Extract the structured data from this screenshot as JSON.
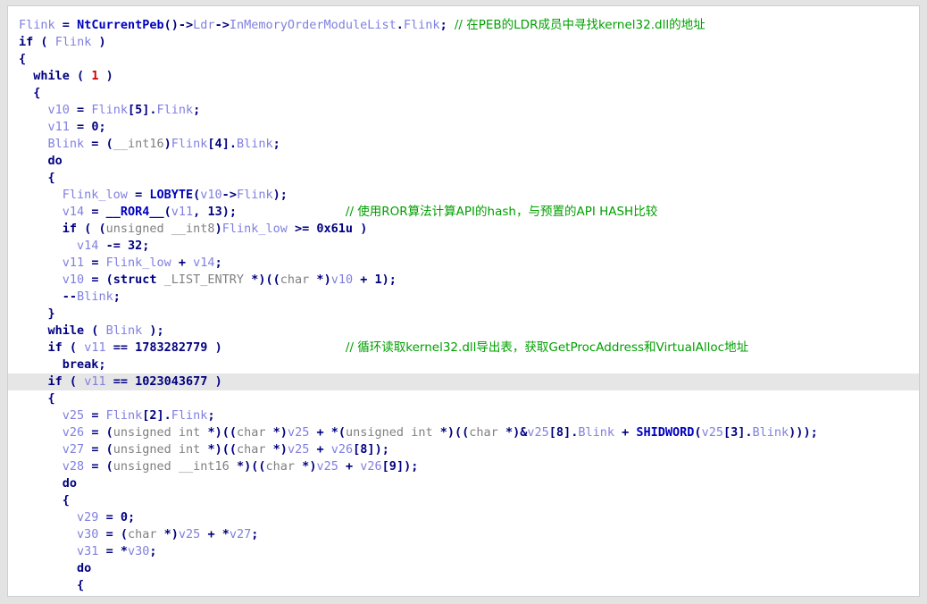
{
  "window": {
    "kind": "decompiler-pseudocode-view",
    "background_color": "#e3e3e3",
    "panel_color": "#ffffff",
    "border_color": "#cfcfcf",
    "highlight_color": "#e6e6e6"
  },
  "colors": {
    "keyword": "#000080",
    "variable": "#8080e0",
    "function": "#0000c0",
    "number": "#000080",
    "number_red": "#d00000",
    "type": "#808080",
    "comment": "#00a000"
  },
  "code": {
    "language": "c-pseudocode",
    "highlighted_line_index": 21,
    "lines": [
      {
        "indent": 0,
        "text": "´",
        "kind": "partial-glyph"
      },
      {
        "indent": 0,
        "text": "Flink = NtCurrentPeb()->Ldr->InMemoryOrderModuleList.Flink;",
        "comment": "// 在PEB的LDR成员中寻找kernel32.dll的地址"
      },
      {
        "indent": 0,
        "text": "if ( Flink )"
      },
      {
        "indent": 0,
        "text": "{"
      },
      {
        "indent": 1,
        "text": "while ( 1 )"
      },
      {
        "indent": 1,
        "text": "{"
      },
      {
        "indent": 2,
        "text": "v10 = Flink[5].Flink;"
      },
      {
        "indent": 2,
        "text": "v11 = 0;"
      },
      {
        "indent": 2,
        "text": "Blink = (__int16)Flink[4].Blink;"
      },
      {
        "indent": 2,
        "text": "do"
      },
      {
        "indent": 2,
        "text": "{"
      },
      {
        "indent": 3,
        "text": "Flink_low = LOBYTE(v10->Flink);"
      },
      {
        "indent": 3,
        "text": "v14 = __ROR4__(v11, 13);",
        "comment": "// 使用ROR算法计算API的hash，与预置的API HASH比较"
      },
      {
        "indent": 3,
        "text": "if ( (unsigned __int8)Flink_low >= 0x61u )"
      },
      {
        "indent": 4,
        "text": "v14 -= 32;"
      },
      {
        "indent": 3,
        "text": "v11 = Flink_low + v14;"
      },
      {
        "indent": 3,
        "text": "v10 = (struct _LIST_ENTRY *)((char *)v10 + 1);"
      },
      {
        "indent": 3,
        "text": "--Blink;"
      },
      {
        "indent": 2,
        "text": "}"
      },
      {
        "indent": 2,
        "text": "while ( Blink );"
      },
      {
        "indent": 2,
        "text": "if ( v11 == 1783282779 )",
        "comment": "// 循环读取kernel32.dll导出表，获取GetProcAddress和VirtualAlloc地址"
      },
      {
        "indent": 3,
        "text": "break;"
      },
      {
        "indent": 2,
        "text": "if ( v11 == 1023043677 )",
        "highlight": true
      },
      {
        "indent": 2,
        "text": "{"
      },
      {
        "indent": 3,
        "text": "v25 = Flink[2].Flink;"
      },
      {
        "indent": 3,
        "text": "v26 = (unsigned int *)((char *)v25 + *(unsigned int *)((char *)&v25[8].Blink + SHIDWORD(v25[3].Blink)));"
      },
      {
        "indent": 3,
        "text": "v27 = (unsigned int *)((char *)v25 + v26[8]);"
      },
      {
        "indent": 3,
        "text": "v28 = (unsigned __int16 *)((char *)v25 + v26[9]);"
      },
      {
        "indent": 3,
        "text": "do"
      },
      {
        "indent": 3,
        "text": "{"
      },
      {
        "indent": 4,
        "text": "v29 = 0;"
      },
      {
        "indent": 4,
        "text": "v30 = (char *)v25 + *v27;"
      },
      {
        "indent": 4,
        "text": "v31 = *v30;"
      },
      {
        "indent": 4,
        "text": "do"
      },
      {
        "indent": 4,
        "text": "{"
      }
    ]
  },
  "comments": [
    "// 在PEB的LDR成员中寻找kernel32.dll的地址",
    "// 使用ROR算法计算API的hash，与预置的API HASH比较",
    "// 循环读取kernel32.dll导出表，获取GetProcAddress和VirtualAlloc地址"
  ]
}
